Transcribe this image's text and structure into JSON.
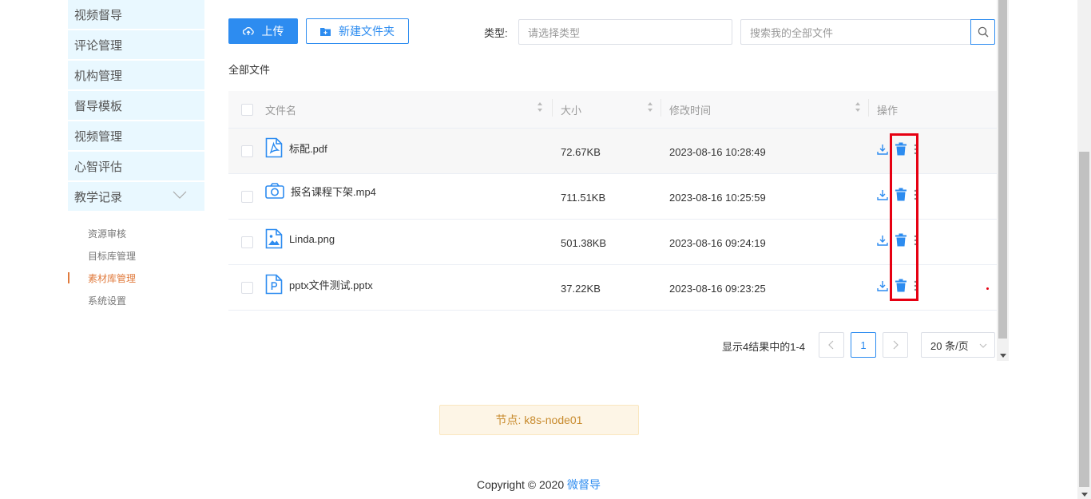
{
  "sidebar": {
    "items": [
      {
        "label": "视频督导"
      },
      {
        "label": "评论管理"
      },
      {
        "label": "机构管理"
      },
      {
        "label": "督导模板"
      },
      {
        "label": "视频管理"
      },
      {
        "label": "心智评估"
      },
      {
        "label": "教学记录"
      }
    ],
    "submenu": [
      {
        "label": "资源审核"
      },
      {
        "label": "目标库管理"
      },
      {
        "label": "素材库管理",
        "active": true
      },
      {
        "label": "系统设置"
      }
    ]
  },
  "toolbar": {
    "upload_label": "上传",
    "new_folder_label": "新建文件夹",
    "type_label": "类型:",
    "type_placeholder": "请选择类型",
    "search_placeholder": "搜索我的全部文件"
  },
  "breadcrumb": "全部文件",
  "table": {
    "headers": {
      "name": "文件名",
      "size": "大小",
      "time": "修改时间",
      "op": "操作"
    },
    "rows": [
      {
        "name": "标配.pdf",
        "size": "72.67KB",
        "time": "2023-08-16 10:28:49",
        "icon": "pdf-file-icon"
      },
      {
        "name": "报名课程下架.mp4",
        "size": "711.51KB",
        "time": "2023-08-16 10:25:59",
        "icon": "camera-icon"
      },
      {
        "name": "Linda.png",
        "size": "501.38KB",
        "time": "2023-08-16 09:24:19",
        "icon": "image-file-icon"
      },
      {
        "name": "pptx文件测试.pptx",
        "size": "37.22KB",
        "time": "2023-08-16 09:23:25",
        "icon": "ppt-file-icon"
      }
    ]
  },
  "pagination": {
    "info": "显示4结果中的1-4",
    "current_page": "1",
    "page_size": "20 条/页"
  },
  "notice": "节点: k8s-node01",
  "footer": {
    "copyright": "Copyright © 2020 ",
    "brand": "微督导"
  },
  "colors": {
    "primary": "#2d8cf0",
    "highlight": "#e60012",
    "active_menu": "#e07a3c"
  }
}
